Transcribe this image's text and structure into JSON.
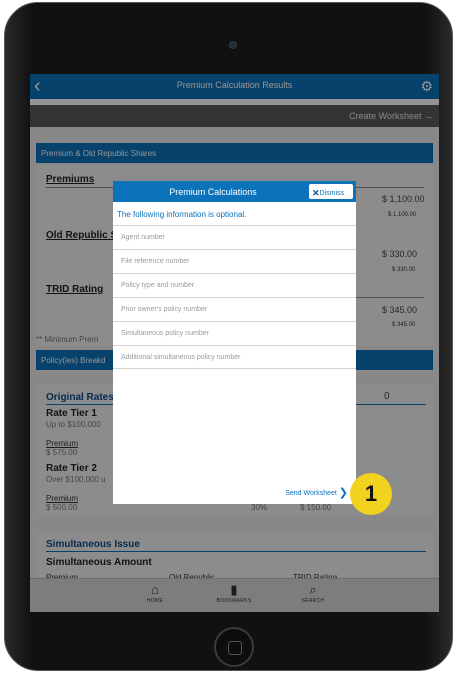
{
  "nav": {
    "title": "Premium Calculation Results"
  },
  "toolbar": {
    "create_worksheet": "Create Worksheet"
  },
  "section1": {
    "header": "Premium & Old Republic Shares",
    "premiums": {
      "label": "Premiums",
      "value": "$ 1,100.00",
      "sub": "$ 1,100.00"
    },
    "old_republic": {
      "label": "Old Republic S",
      "value": "$ 330.00",
      "sub": "$ 330.00"
    },
    "trid": {
      "label": "TRID Rating",
      "value": "$ 345.00",
      "sub": "$ 345.00"
    },
    "minimum": "** Minimum Prem"
  },
  "section2": {
    "header": "Policy(ies) Breakd",
    "original_rates": "Original Rates",
    "digit": "0",
    "tier1": {
      "label": "Rate Tier 1",
      "range": "Up to $100,000",
      "premium_label": "Premium",
      "premium_value": "$ 575.00"
    },
    "tier2": {
      "label": "Rate Tier 2",
      "range": "Over $100,000 u",
      "premium_label": "Premium",
      "premium_value": "$ 500.00",
      "pct": "30%",
      "share": "$ 150.00"
    }
  },
  "section3": {
    "title": "Simultaneous Issue",
    "amount_label": "Simultaneous Amount",
    "cols": [
      "Premium",
      "Old Republic",
      "TRID Rating"
    ]
  },
  "tabbar": [
    {
      "label": "HOME",
      "icon": "home-icon"
    },
    {
      "label": "BOOKMARKS",
      "icon": "bookmark-icon"
    },
    {
      "label": "SEARCH",
      "icon": "search-icon"
    }
  ],
  "modal": {
    "title": "Premium Calculations",
    "dismiss": "Dismiss",
    "info": "The following information is optional.",
    "fields": [
      "Agent number",
      "File reference number",
      "Policy type and number",
      "Prior owner's policy number",
      "Simultaneous policy number",
      "Additional simultaneous policy number"
    ],
    "send": "Send Worksheet"
  },
  "badge": "1",
  "colors": {
    "accent": "#0c73bb",
    "badge": "#f3d11f"
  }
}
